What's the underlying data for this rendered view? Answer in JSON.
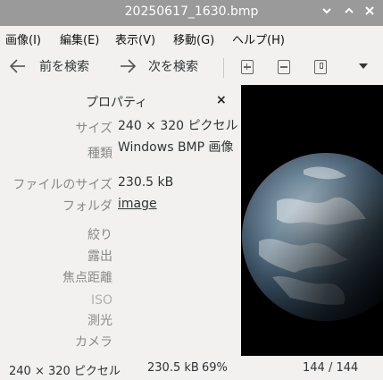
{
  "window": {
    "title": "20250617_1630.bmp",
    "controls": {
      "minimize_icon": "chevron-down-icon",
      "maximize_icon": "chevron-up-icon",
      "close_icon": "close-icon"
    }
  },
  "menubar": {
    "items": [
      "画像(I)",
      "編集(E)",
      "表示(V)",
      "移動(G)",
      "ヘルプ(H)"
    ]
  },
  "toolbar": {
    "prev_label": "前を検索",
    "next_label": "次を検索",
    "icons": [
      "zoom-in-icon",
      "zoom-fit-icon",
      "zoom-out-icon",
      "menu-dropdown-icon"
    ]
  },
  "properties": {
    "title": "プロパティ",
    "close_glyph": "×",
    "rows": [
      {
        "label": "サイズ",
        "value": "240 × 320 ピクセル"
      },
      {
        "label": "種類",
        "value": "Windows BMP 画像"
      },
      {
        "label": "ファイルのサイズ",
        "value": "230.5 kB"
      },
      {
        "label": "フォルダ",
        "value": "image"
      },
      {
        "label": "絞り",
        "value": ""
      },
      {
        "label": "露出",
        "value": ""
      },
      {
        "label": "焦点距離",
        "value": ""
      },
      {
        "label": "ISO",
        "value": ""
      },
      {
        "label": "測光",
        "value": ""
      },
      {
        "label": "カメラ",
        "value": ""
      }
    ]
  },
  "statusbar": {
    "dimensions": "240 × 320 ピクセル",
    "filesize": "230.5 kB",
    "zoom": "69%",
    "position": "144 / 144"
  },
  "colors": {
    "titlebar_bg": "#9a9a9a",
    "window_bg": "#f2f1f0",
    "label_gray": "#888a85",
    "image_bg": "#000000"
  }
}
